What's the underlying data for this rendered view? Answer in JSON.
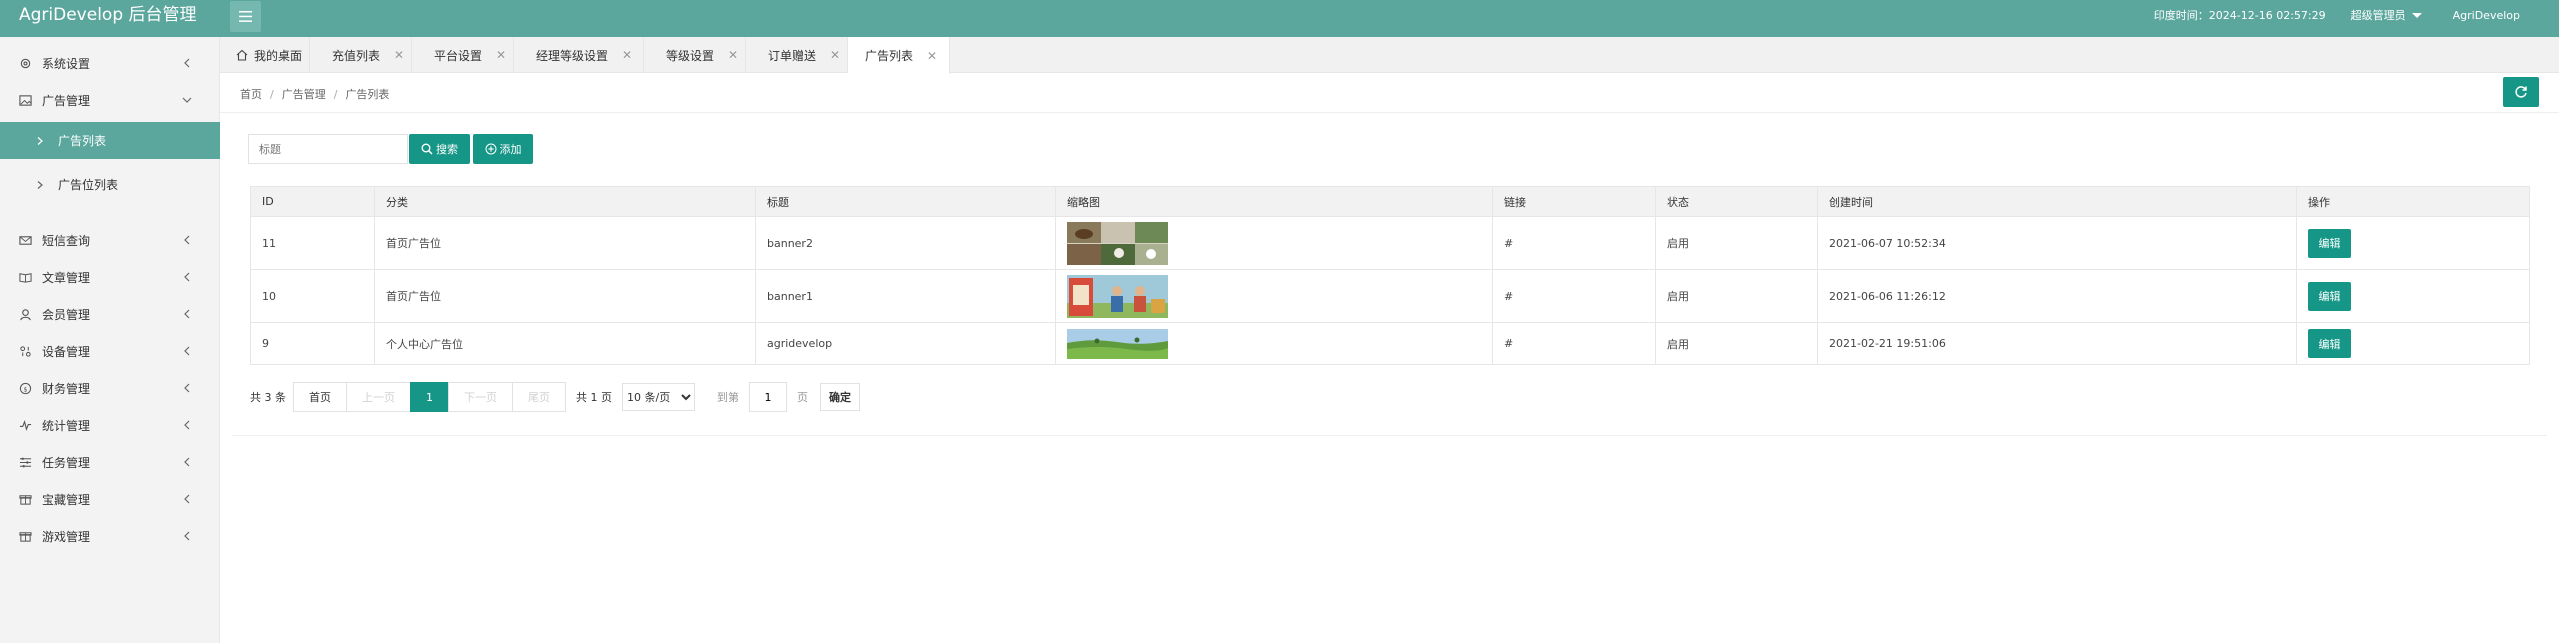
{
  "header": {
    "brand": "AgriDevelop 后台管理",
    "time": "印度时间：2024-12-16 02:57:29",
    "role": "超级管理员",
    "app_name": "AgriDevelop"
  },
  "sidebar": {
    "items": [
      {
        "label": "系统设置",
        "icon": "gear-icon"
      },
      {
        "label": "广告管理",
        "icon": "image-icon",
        "expanded": true
      },
      {
        "label": "短信查询",
        "icon": "mail-icon"
      },
      {
        "label": "文章管理",
        "icon": "book-icon"
      },
      {
        "label": "会员管理",
        "icon": "user-icon"
      },
      {
        "label": "设备管理",
        "icon": "device-icon"
      },
      {
        "label": "财务管理",
        "icon": "finance-icon"
      },
      {
        "label": "统计管理",
        "icon": "stats-icon"
      },
      {
        "label": "任务管理",
        "icon": "task-icon"
      },
      {
        "label": "宝藏管理",
        "icon": "treasure-icon"
      },
      {
        "label": "游戏管理",
        "icon": "game-icon"
      }
    ],
    "subitems": [
      {
        "label": "广告列表",
        "active": true
      },
      {
        "label": "广告位列表",
        "active": false
      }
    ]
  },
  "tabs": [
    {
      "label": "我的桌面",
      "closable": false
    },
    {
      "label": "充值列表",
      "closable": true
    },
    {
      "label": "平台设置",
      "closable": true
    },
    {
      "label": "经理等级设置",
      "closable": true
    },
    {
      "label": "等级设置",
      "closable": true
    },
    {
      "label": "订单赠送",
      "closable": true
    },
    {
      "label": "广告列表",
      "closable": true,
      "active": true
    }
  ],
  "breadcrumb": [
    "首页",
    "广告管理",
    "广告列表"
  ],
  "toolbar": {
    "search_placeholder": "标题",
    "search_label": "搜索",
    "add_label": "添加"
  },
  "table": {
    "columns": [
      "ID",
      "分类",
      "标题",
      "缩略图",
      "链接",
      "状态",
      "创建时间",
      "操作"
    ],
    "rows": [
      {
        "id": "11",
        "category": "首页广告位",
        "title": "banner2",
        "thumb": "farm-collage",
        "link": "#",
        "status": "启用",
        "created": "2021-06-07 10:52:34",
        "action": "编辑"
      },
      {
        "id": "10",
        "category": "首页广告位",
        "title": "banner1",
        "thumb": "farmers-banner",
        "link": "#",
        "status": "启用",
        "created": "2021-06-06 11:26:12",
        "action": "编辑"
      },
      {
        "id": "9",
        "category": "个人中心广告位",
        "title": "agridevelop",
        "thumb": "green-field",
        "link": "#",
        "status": "启用",
        "created": "2021-02-21 19:51:06",
        "action": "编辑"
      }
    ]
  },
  "pagination": {
    "count_text": "共 3 条",
    "first": "首页",
    "prev": "上一页",
    "current": "1",
    "next": "下一页",
    "last": "尾页",
    "total_pages": "共 1 页",
    "page_size": "10 条/页",
    "goto_label": "到第",
    "goto_value": "1",
    "page_label": "页",
    "confirm": "确定"
  },
  "colors": {
    "header": "#5ba79d",
    "primary": "#169686",
    "sidebar_bg": "#f3f3f3",
    "active_sub": "#5ba79d"
  }
}
